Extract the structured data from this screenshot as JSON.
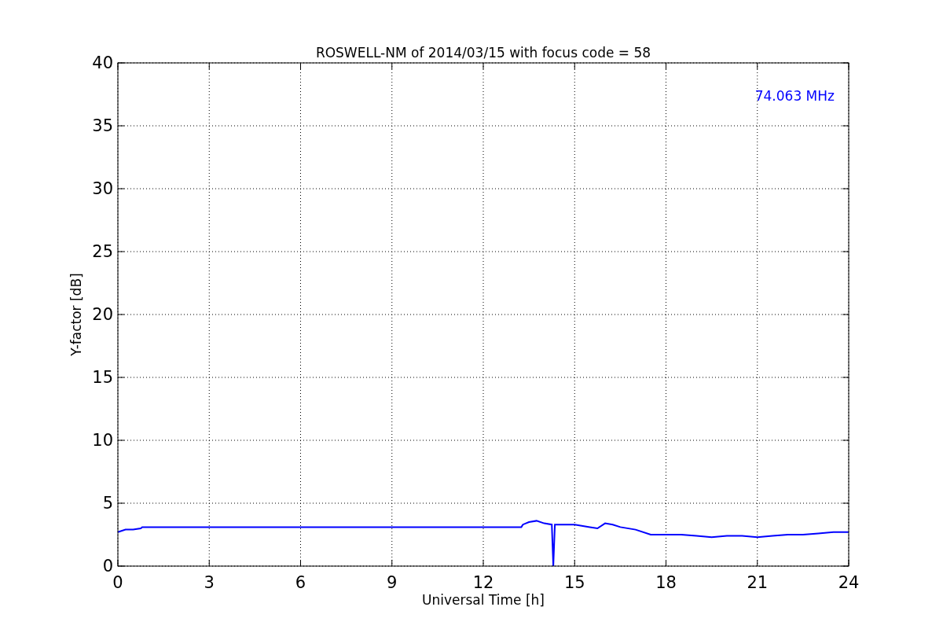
{
  "figure": {
    "chart_data": {
      "type": "line",
      "title": "ROSWELL-NM of 2014/03/15 with focus code = 58",
      "xlabel": "Universal Time [h]",
      "ylabel": "Y-factor [dB]",
      "x": [
        0,
        0.25,
        0.5,
        0.75,
        0.8,
        13.25,
        13.3,
        13.5,
        13.75,
        14,
        14.25,
        14.3,
        14.35,
        14.5,
        15,
        15.5,
        15.75,
        16,
        16.25,
        16.5,
        17,
        17.5,
        18,
        18.5,
        19,
        19.5,
        20,
        20.5,
        21,
        21.5,
        22,
        22.5,
        23,
        23.5,
        24
      ],
      "series": [
        {
          "name": "74.063 MHz",
          "color": "#0000ff",
          "values": [
            2.7,
            2.9,
            2.9,
            3.0,
            3.1,
            3.1,
            3.3,
            3.5,
            3.6,
            3.4,
            3.3,
            0,
            3.3,
            3.3,
            3.3,
            3.1,
            3.0,
            3.4,
            3.3,
            3.1,
            2.9,
            2.5,
            2.5,
            2.5,
            2.4,
            2.3,
            2.4,
            2.4,
            2.3,
            2.4,
            2.5,
            2.5,
            2.6,
            2.7,
            2.7
          ]
        }
      ],
      "xlim": [
        0,
        24
      ],
      "ylim": [
        0,
        40
      ],
      "xticks": [
        0,
        3,
        6,
        9,
        12,
        15,
        18,
        21,
        24
      ],
      "yticks": [
        0,
        5,
        10,
        15,
        20,
        25,
        30,
        35,
        40
      ],
      "grid": true
    }
  }
}
